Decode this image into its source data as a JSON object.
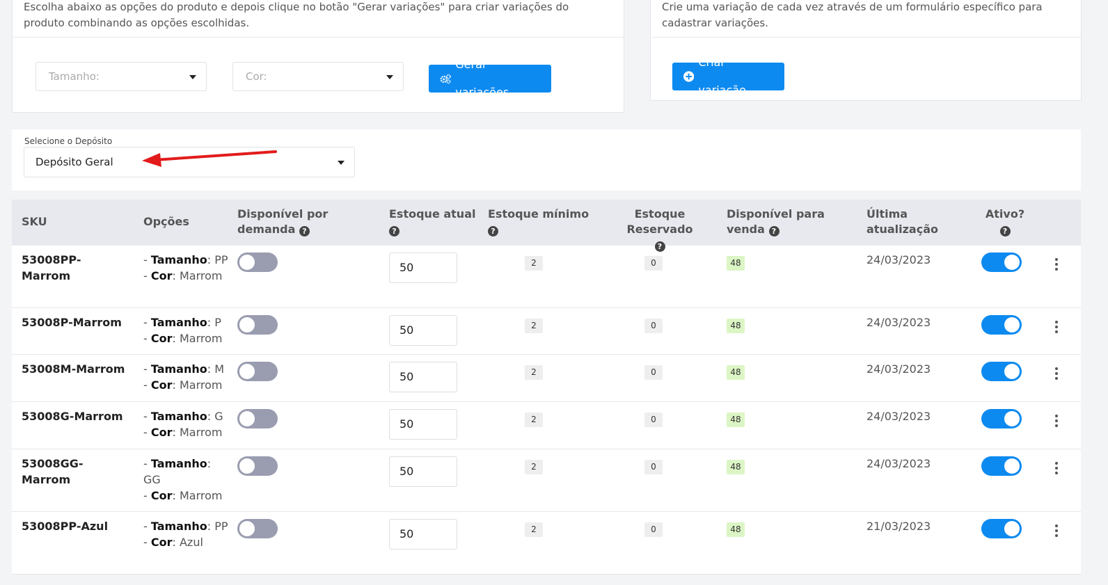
{
  "gen_card": {
    "description": "Escolha abaixo as opções do produto e depois clique no botão \"Gerar variações\" para criar variações do produto combinando as opções escolhidas.",
    "size_placeholder": "Tamanho:",
    "color_placeholder": "Cor:",
    "generate_label": "Gerar variações"
  },
  "create_card": {
    "description": "Crie uma variação de cada vez através de um formulário específico para cadastrar variações.",
    "create_label": "Criar variação"
  },
  "deposit": {
    "label": "Selecione o Depósito",
    "value": "Depósito Geral"
  },
  "table": {
    "headers": {
      "sku": "SKU",
      "options": "Opções",
      "on_demand": "Disponível por demanda",
      "stock": "Estoque atual",
      "min_stock": "Estoque mínimo",
      "reserved": "Estoque Reservado",
      "available": "Disponível para venda",
      "updated": "Última atualização",
      "active": "Ativo?"
    },
    "size_key": "Tamanho",
    "color_key": "Cor",
    "rows": [
      {
        "sku": "53008PP-Marrom",
        "size": "PP",
        "color": "Marrom",
        "stock": "50",
        "min": "2",
        "reserved": "0",
        "available": "48",
        "date": "24/03/2023",
        "on_demand": false,
        "active": true
      },
      {
        "sku": "53008P-Marrom",
        "size": "P",
        "color": "Marrom",
        "stock": "50",
        "min": "2",
        "reserved": "0",
        "available": "48",
        "date": "24/03/2023",
        "on_demand": false,
        "active": true
      },
      {
        "sku": "53008M-Marrom",
        "size": "M",
        "color": "Marrom",
        "stock": "50",
        "min": "2",
        "reserved": "0",
        "available": "48",
        "date": "24/03/2023",
        "on_demand": false,
        "active": true
      },
      {
        "sku": "53008G-Marrom",
        "size": "G",
        "color": "Marrom",
        "stock": "50",
        "min": "2",
        "reserved": "0",
        "available": "48",
        "date": "24/03/2023",
        "on_demand": false,
        "active": true
      },
      {
        "sku": "53008GG-Marrom",
        "size": "GG",
        "color": "Marrom",
        "stock": "50",
        "min": "2",
        "reserved": "0",
        "available": "48",
        "date": "24/03/2023",
        "on_demand": false,
        "active": true
      },
      {
        "sku": "53008PP-Azul",
        "size": "PP",
        "color": "Azul",
        "stock": "50",
        "min": "2",
        "reserved": "0",
        "available": "48",
        "date": "21/03/2023",
        "on_demand": false,
        "active": true
      }
    ]
  },
  "colors": {
    "primary": "#0d8af0",
    "arrow": "#e21b1b",
    "available_badge": "#dcf5c5"
  }
}
